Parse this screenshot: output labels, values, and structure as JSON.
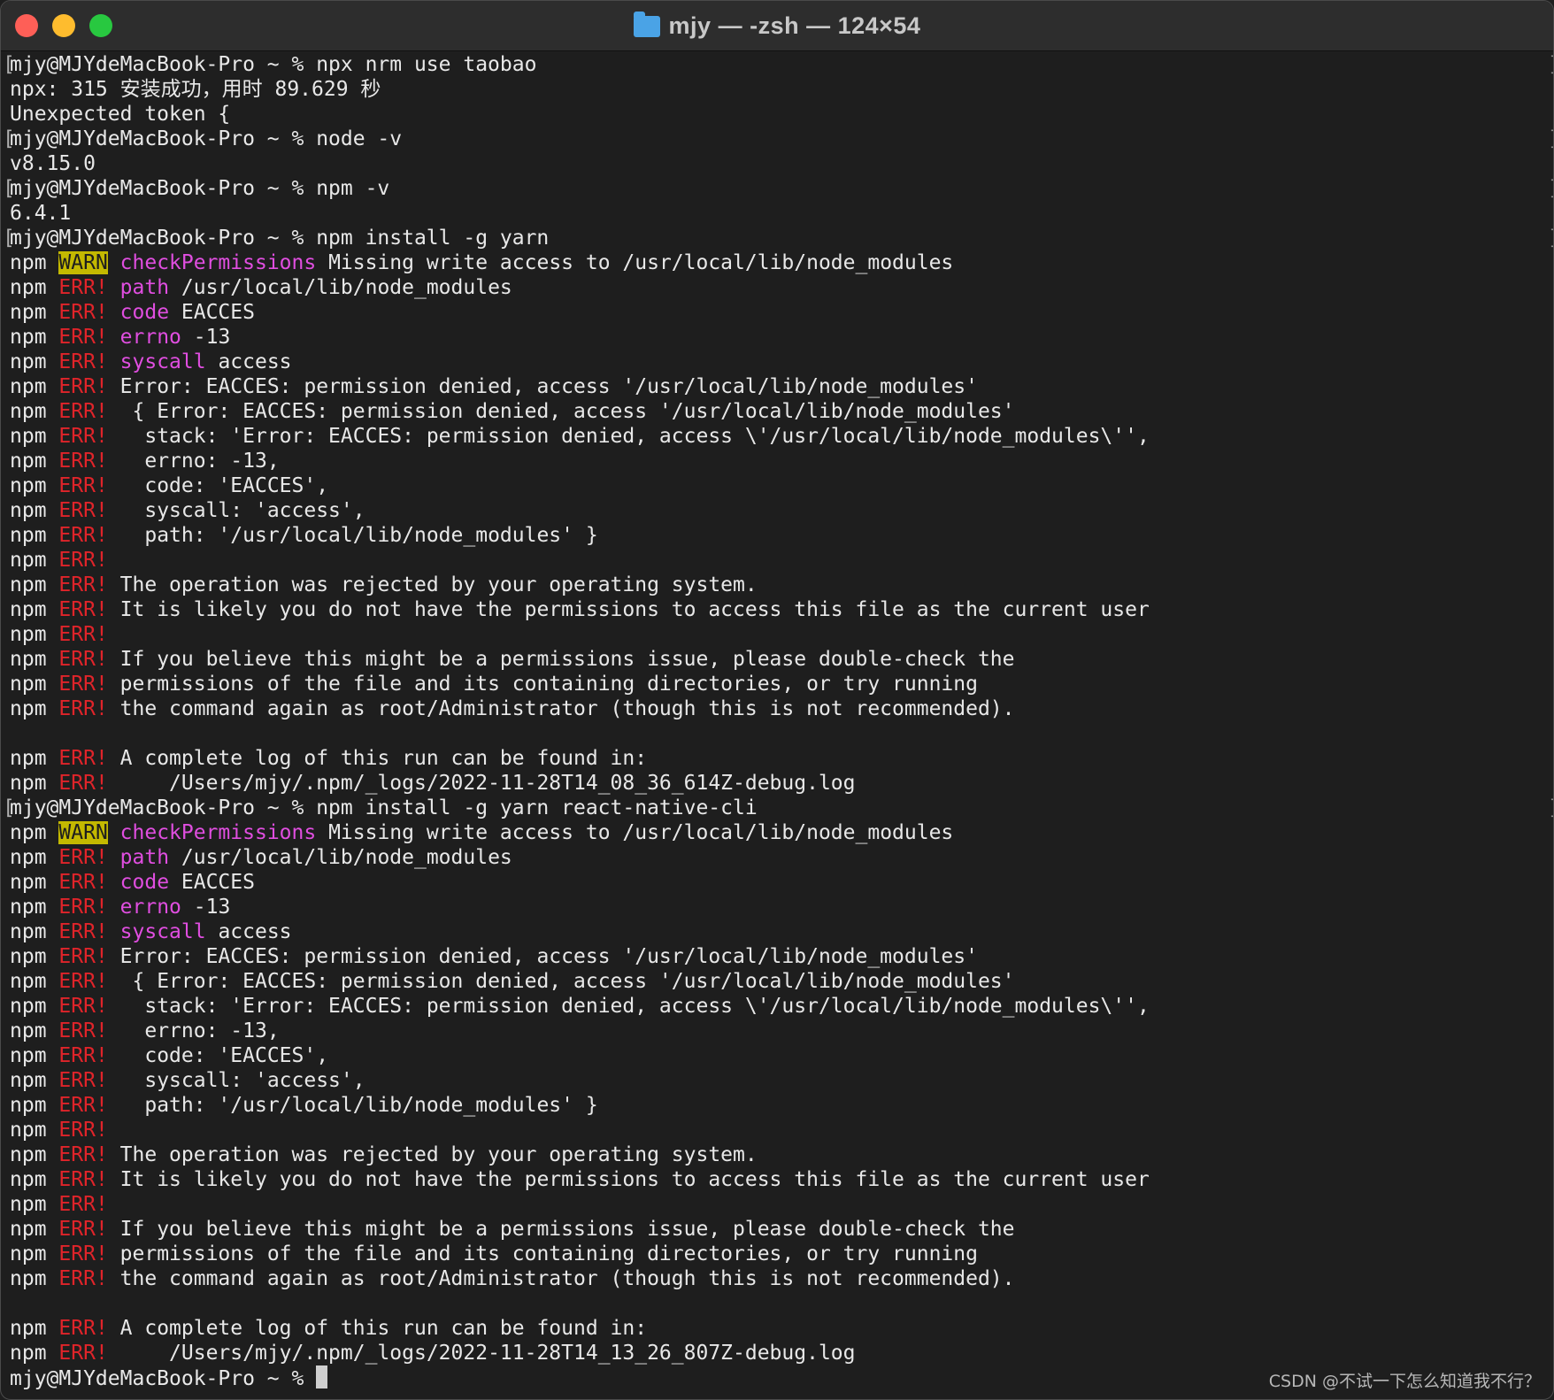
{
  "window": {
    "title": "mjy — -zsh — 124×54"
  },
  "prompt": "mjy@MJYdeMacBook-Pro ~ % ",
  "lines": [
    {
      "type": "prompt",
      "cmd": "npx nrm use taobao"
    },
    {
      "type": "plain",
      "text": "npx: 315 安装成功，用时 89.629 秒"
    },
    {
      "type": "plain",
      "text": "Unexpected token {"
    },
    {
      "type": "prompt",
      "cmd": "node -v"
    },
    {
      "type": "plain",
      "text": "v8.15.0"
    },
    {
      "type": "prompt",
      "cmd": "npm -v"
    },
    {
      "type": "plain",
      "text": "6.4.1"
    },
    {
      "type": "prompt",
      "cmd": "npm install -g yarn"
    },
    {
      "type": "npm",
      "level": "WARN",
      "key": "checkPermissions",
      "text": " Missing write access to /usr/local/lib/node_modules"
    },
    {
      "type": "npm",
      "level": "ERR!",
      "key": "path",
      "text": " /usr/local/lib/node_modules"
    },
    {
      "type": "npm",
      "level": "ERR!",
      "key": "code",
      "text": " EACCES"
    },
    {
      "type": "npm",
      "level": "ERR!",
      "key": "errno",
      "text": " -13"
    },
    {
      "type": "npm",
      "level": "ERR!",
      "key": "syscall",
      "text": " access"
    },
    {
      "type": "npm",
      "level": "ERR!",
      "key": "",
      "text": "Error: EACCES: permission denied, access '/usr/local/lib/node_modules'"
    },
    {
      "type": "npm",
      "level": "ERR!",
      "key": "",
      "text": " { Error: EACCES: permission denied, access '/usr/local/lib/node_modules'"
    },
    {
      "type": "npm",
      "level": "ERR!",
      "key": "",
      "text": "  stack: 'Error: EACCES: permission denied, access \\'/usr/local/lib/node_modules\\'',"
    },
    {
      "type": "npm",
      "level": "ERR!",
      "key": "",
      "text": "  errno: -13,"
    },
    {
      "type": "npm",
      "level": "ERR!",
      "key": "",
      "text": "  code: 'EACCES',"
    },
    {
      "type": "npm",
      "level": "ERR!",
      "key": "",
      "text": "  syscall: 'access',"
    },
    {
      "type": "npm",
      "level": "ERR!",
      "key": "",
      "text": "  path: '/usr/local/lib/node_modules' }"
    },
    {
      "type": "npm",
      "level": "ERR!",
      "key": "",
      "text": ""
    },
    {
      "type": "npm",
      "level": "ERR!",
      "key": "",
      "text": "The operation was rejected by your operating system."
    },
    {
      "type": "npm",
      "level": "ERR!",
      "key": "",
      "text": "It is likely you do not have the permissions to access this file as the current user"
    },
    {
      "type": "npm",
      "level": "ERR!",
      "key": "",
      "text": ""
    },
    {
      "type": "npm",
      "level": "ERR!",
      "key": "",
      "text": "If you believe this might be a permissions issue, please double-check the"
    },
    {
      "type": "npm",
      "level": "ERR!",
      "key": "",
      "text": "permissions of the file and its containing directories, or try running"
    },
    {
      "type": "npm",
      "level": "ERR!",
      "key": "",
      "text": "the command again as root/Administrator (though this is not recommended)."
    },
    {
      "type": "plain",
      "text": ""
    },
    {
      "type": "npm",
      "level": "ERR!",
      "key": "",
      "text": "A complete log of this run can be found in:"
    },
    {
      "type": "npm",
      "level": "ERR!",
      "key": "",
      "text": "    /Users/mjy/.npm/_logs/2022-11-28T14_08_36_614Z-debug.log"
    },
    {
      "type": "prompt",
      "cmd": "npm install -g yarn react-native-cli"
    },
    {
      "type": "npm",
      "level": "WARN",
      "key": "checkPermissions",
      "text": " Missing write access to /usr/local/lib/node_modules"
    },
    {
      "type": "npm",
      "level": "ERR!",
      "key": "path",
      "text": " /usr/local/lib/node_modules"
    },
    {
      "type": "npm",
      "level": "ERR!",
      "key": "code",
      "text": " EACCES"
    },
    {
      "type": "npm",
      "level": "ERR!",
      "key": "errno",
      "text": " -13"
    },
    {
      "type": "npm",
      "level": "ERR!",
      "key": "syscall",
      "text": " access"
    },
    {
      "type": "npm",
      "level": "ERR!",
      "key": "",
      "text": "Error: EACCES: permission denied, access '/usr/local/lib/node_modules'"
    },
    {
      "type": "npm",
      "level": "ERR!",
      "key": "",
      "text": " { Error: EACCES: permission denied, access '/usr/local/lib/node_modules'"
    },
    {
      "type": "npm",
      "level": "ERR!",
      "key": "",
      "text": "  stack: 'Error: EACCES: permission denied, access \\'/usr/local/lib/node_modules\\'',"
    },
    {
      "type": "npm",
      "level": "ERR!",
      "key": "",
      "text": "  errno: -13,"
    },
    {
      "type": "npm",
      "level": "ERR!",
      "key": "",
      "text": "  code: 'EACCES',"
    },
    {
      "type": "npm",
      "level": "ERR!",
      "key": "",
      "text": "  syscall: 'access',"
    },
    {
      "type": "npm",
      "level": "ERR!",
      "key": "",
      "text": "  path: '/usr/local/lib/node_modules' }"
    },
    {
      "type": "npm",
      "level": "ERR!",
      "key": "",
      "text": ""
    },
    {
      "type": "npm",
      "level": "ERR!",
      "key": "",
      "text": "The operation was rejected by your operating system."
    },
    {
      "type": "npm",
      "level": "ERR!",
      "key": "",
      "text": "It is likely you do not have the permissions to access this file as the current user"
    },
    {
      "type": "npm",
      "level": "ERR!",
      "key": "",
      "text": ""
    },
    {
      "type": "npm",
      "level": "ERR!",
      "key": "",
      "text": "If you believe this might be a permissions issue, please double-check the"
    },
    {
      "type": "npm",
      "level": "ERR!",
      "key": "",
      "text": "permissions of the file and its containing directories, or try running"
    },
    {
      "type": "npm",
      "level": "ERR!",
      "key": "",
      "text": "the command again as root/Administrator (though this is not recommended)."
    },
    {
      "type": "plain",
      "text": ""
    },
    {
      "type": "npm",
      "level": "ERR!",
      "key": "",
      "text": "A complete log of this run can be found in:"
    },
    {
      "type": "npm",
      "level": "ERR!",
      "key": "",
      "text": "    /Users/mjy/.npm/_logs/2022-11-28T14_13_26_807Z-debug.log"
    },
    {
      "type": "current",
      "cmd": ""
    }
  ],
  "watermark": "CSDN @不试一下怎么知道我不行？",
  "colors": {
    "warn_bg": "#c4b900",
    "err_fg": "#e0242a",
    "key_fg": "#e04ee0"
  }
}
